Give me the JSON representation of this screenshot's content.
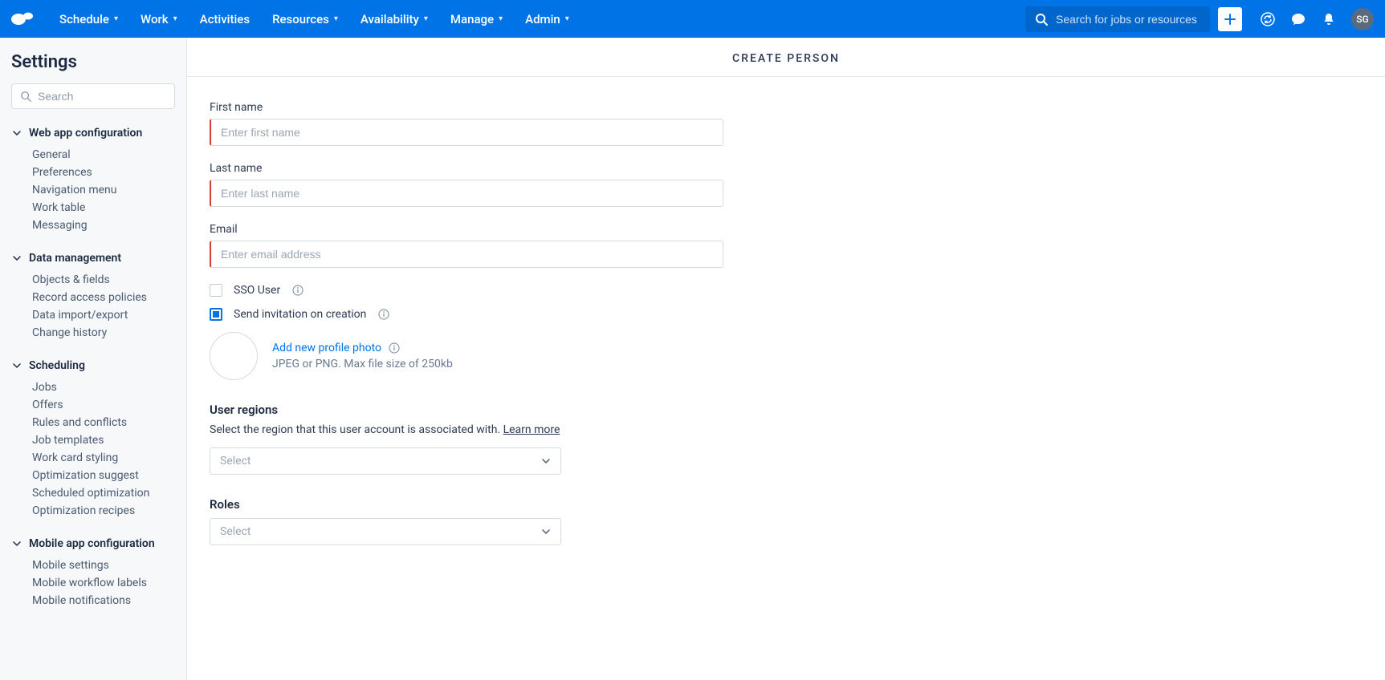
{
  "topnav": {
    "items": [
      "Schedule",
      "Work",
      "Activities",
      "Resources",
      "Availability",
      "Manage",
      "Admin"
    ],
    "search_placeholder": "Search for jobs or resources",
    "avatar_initials": "SG"
  },
  "sidebar": {
    "title": "Settings",
    "search_placeholder": "Search",
    "groups": [
      {
        "label": "Web app configuration",
        "items": [
          "General",
          "Preferences",
          "Navigation menu",
          "Work table",
          "Messaging"
        ]
      },
      {
        "label": "Data management",
        "items": [
          "Objects & fields",
          "Record access policies",
          "Data import/export",
          "Change history"
        ]
      },
      {
        "label": "Scheduling",
        "items": [
          "Jobs",
          "Offers",
          "Rules and conflicts",
          "Job templates",
          "Work card styling",
          "Optimization suggest",
          "Scheduled optimization",
          "Optimization recipes"
        ]
      },
      {
        "label": "Mobile app configuration",
        "items": [
          "Mobile settings",
          "Mobile workflow labels",
          "Mobile notifications"
        ]
      }
    ]
  },
  "main": {
    "title": "CREATE PERSON",
    "first_name_label": "First name",
    "first_name_placeholder": "Enter first name",
    "last_name_label": "Last name",
    "last_name_placeholder": "Enter last name",
    "email_label": "Email",
    "email_placeholder": "Enter email address",
    "sso_label": "SSO User",
    "sso_checked": false,
    "invite_label": "Send invitation on creation",
    "invite_checked": true,
    "photo_link": "Add new profile photo",
    "photo_hint": "JPEG or PNG. Max file size of 250kb",
    "regions_head": "User regions",
    "regions_desc": "Select the region that this user account is associated with. ",
    "learn_more": "Learn more",
    "regions_select_placeholder": "Select",
    "roles_head": "Roles",
    "roles_select_placeholder": "Select"
  }
}
